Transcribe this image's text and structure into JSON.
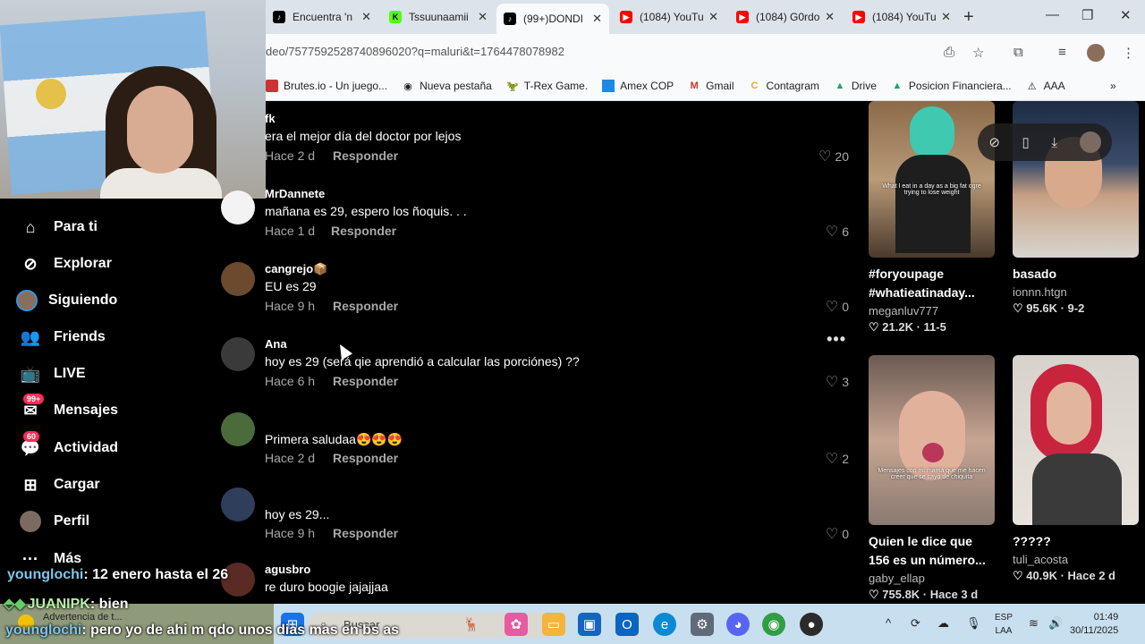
{
  "browser": {
    "tabs": [
      {
        "label": "Encuentra 'n",
        "icon": "tiktok-icon",
        "color": "#000000"
      },
      {
        "label": "Tssuunaamii",
        "icon": "kick-icon",
        "color": "#53fc18"
      },
      {
        "label": "(99+)DONDI",
        "icon": "tiktok-icon",
        "color": "#000000"
      },
      {
        "label": "(1084) YouTu",
        "icon": "youtube-icon",
        "color": "#ff0000"
      },
      {
        "label": "(1084) G0rdo",
        "icon": "youtube-icon",
        "color": "#ff0000"
      },
      {
        "label": "(1084) YouTu",
        "icon": "youtube-icon",
        "color": "#ff0000"
      }
    ],
    "active_tab": 2,
    "url": "deo/7577592528740896020?q=maluri&t=1764478078982",
    "bookmarks": [
      "Brutes.io - Un juego...",
      "Nueva pestaña",
      "T-Rex Game.",
      "Amex COP",
      "Gmail",
      "Contagram",
      "Drive",
      "Posicion Financiera...",
      "AAA"
    ]
  },
  "sidebar": {
    "items": [
      {
        "label": "Para ti",
        "icon": "home-icon"
      },
      {
        "label": "Explorar",
        "icon": "compass-icon"
      },
      {
        "label": "Siguiendo",
        "icon": "avatar-icon"
      },
      {
        "label": "Friends",
        "icon": "friends-icon"
      },
      {
        "label": "LIVE",
        "icon": "live-icon"
      },
      {
        "label": "Mensajes",
        "icon": "messages-icon",
        "badge": "99+"
      },
      {
        "label": "Actividad",
        "icon": "activity-icon",
        "badge": "60"
      },
      {
        "label": "Cargar",
        "icon": "upload-icon"
      },
      {
        "label": "Perfil",
        "icon": "profile-icon"
      },
      {
        "label": "Más",
        "icon": "more-icon"
      }
    ]
  },
  "comments": [
    {
      "user": "fk",
      "text": "era el mejor día del doctor por lejos",
      "time": "Hace 2 d",
      "reply": "Responder",
      "likes": "20"
    },
    {
      "user": "MrDannete",
      "text": "mañana es 29, espero los ñoquis. . .",
      "time": "Hace 1 d",
      "reply": "Responder",
      "likes": "6"
    },
    {
      "user": "cangrejo📦",
      "text": "EU es 29",
      "time": "Hace 9 h",
      "reply": "Responder",
      "likes": "0"
    },
    {
      "user": "Ana",
      "text": "hoy es 29 (será qie aprendió a calcular las porciónes) ??",
      "time": "Hace 6 h",
      "reply": "Responder",
      "likes": "3"
    },
    {
      "user": "",
      "text": "Primera saludaa😍😍😍",
      "time": "Hace 2 d",
      "reply": "Responder",
      "likes": "2"
    },
    {
      "user": "",
      "text": "hoy es 29...",
      "time": "Hace 9 h",
      "reply": "Responder",
      "likes": "0"
    },
    {
      "user": "agusbro",
      "text": "re duro boogie jajajjaa",
      "time": "",
      "reply": "",
      "likes": ""
    }
  ],
  "videos": [
    {
      "title1": "#foryoupage",
      "title2": "#whatieatinaday...",
      "author": "meganluv777",
      "stats": "♡ 21.2K · 11-5",
      "caption": "What I eat in a day as a big fat ogre trying to lose weight"
    },
    {
      "title1": "basado",
      "title2": "",
      "author": "ionnn.htgn",
      "stats": "♡ 95.6K · 9-2",
      "caption": ""
    },
    {
      "title1": "Quien le dice que",
      "title2": "156 es un número...",
      "author": "gaby_ellap",
      "stats": "♡ 755.8K · Hace 3 d",
      "caption": "Mensajes con mi mamá que me hacen creer que se cayó de chiquita"
    },
    {
      "title1": "?????",
      "title2": "",
      "author": "tuli_acosta",
      "stats": "♡ 40.9K · Hace 2 d",
      "caption": ""
    }
  ],
  "chat": [
    {
      "user": "younglochi",
      "msg": ": 12 enero hasta el 26"
    },
    {
      "user": "JUANIPK",
      "msg": ": bien"
    },
    {
      "user": "younglochi",
      "msg": ": pero yo de ahi m qdo unos dias mas en bs as"
    }
  ],
  "taskbar": {
    "warning": "Advertencia de t...",
    "search_placeholder": "Buscar",
    "lang1": "ESP",
    "lang2": "LAA",
    "time": "01:49",
    "date": "30/11/2025"
  }
}
